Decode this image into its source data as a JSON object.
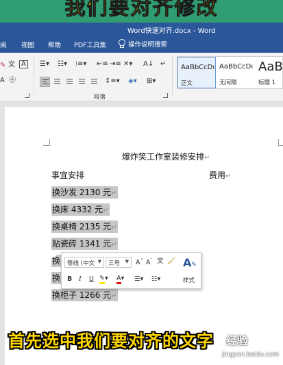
{
  "overlay": {
    "top_banner": "我们要对齐修改"
  },
  "window": {
    "title": "Word快速对齐.docx  -  Word"
  },
  "tabs": {
    "items": [
      "阅",
      "视图",
      "帮助",
      "PDF工具集"
    ],
    "tell_me": "操作说明搜索"
  },
  "ribbon": {
    "paragraph_group_label": "段落",
    "styles": [
      {
        "preview": "AaBbCcDı",
        "name": "正文",
        "selected": true
      },
      {
        "preview": "AaBbCcDı",
        "name": "无间隔",
        "selected": false
      },
      {
        "preview": "AaB",
        "name": "标题 1",
        "selected": false
      }
    ]
  },
  "document": {
    "title": "爆炸笑工作室装修安排",
    "header_left": "事宜安排",
    "header_right": "费用",
    "lines": [
      "换沙发 2130 元",
      "换床 4332 元",
      "换桌椅 2135 元",
      "贴瓷砖 1341 元",
      "换",
      "换",
      "换柜子 1266 元"
    ]
  },
  "mini_toolbar": {
    "font_name": "等线 (中文",
    "font_size": "三号",
    "styles_label": "样式"
  },
  "subtitle": "首先选中我们要对齐的文字",
  "watermark": {
    "logo": "经验",
    "url": "jingyan.baidu.com"
  },
  "colors": {
    "word_blue": "#2b579a",
    "font_color_red": "#e01010",
    "highlight_yellow": "#ffe600",
    "subtitle_yellow": "#ffd700"
  }
}
